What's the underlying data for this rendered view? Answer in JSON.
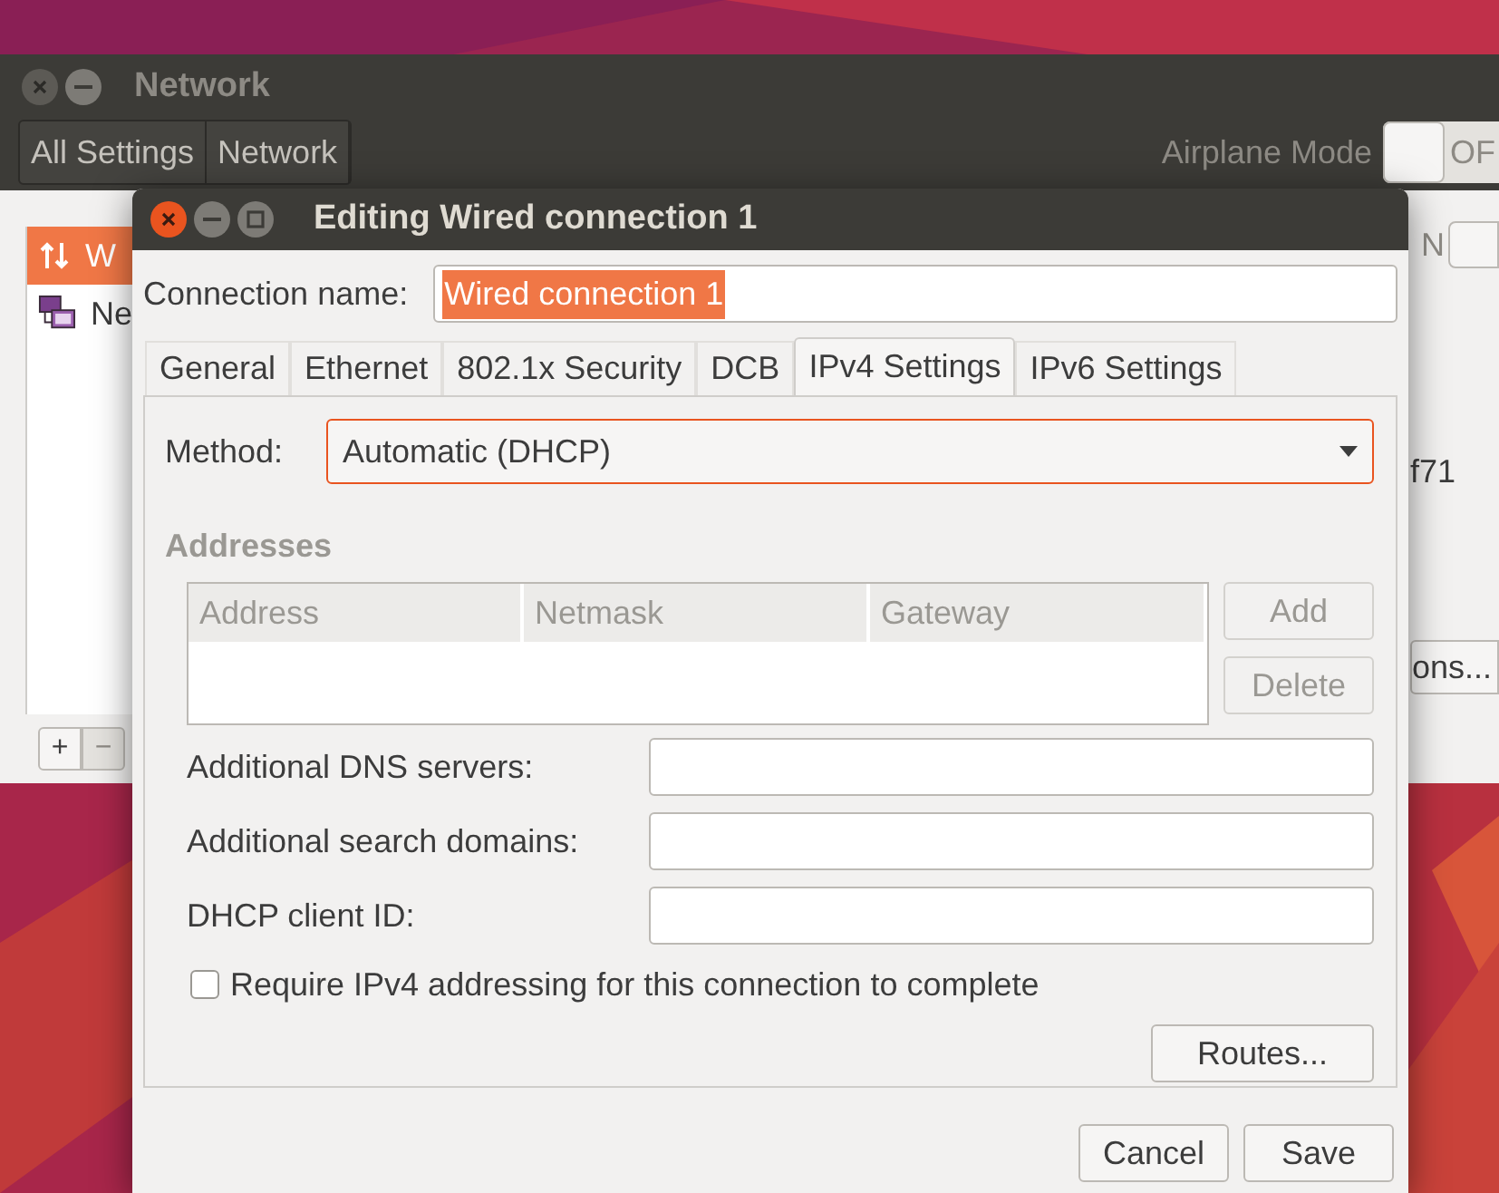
{
  "background_window": {
    "title": "Network",
    "toolbar": [
      "All Settings",
      "Network"
    ],
    "airplane_mode": {
      "label": "Airplane Mode",
      "switch_text": "OF",
      "on": false
    },
    "sidebar": {
      "items": [
        {
          "label": "W",
          "kind": "wired",
          "selected": true
        },
        {
          "label": "Ne",
          "kind": "network",
          "selected": false
        }
      ],
      "buttons": [
        "+",
        "−"
      ]
    },
    "detail": {
      "switch_text": "N",
      "switch_on": true,
      "text": "f71",
      "button": "ons..."
    }
  },
  "dialog": {
    "title": "Editing Wired connection 1",
    "connection_name": {
      "label": "Connection name:",
      "value": "Wired connection 1",
      "text_selected": true
    },
    "tabs": [
      {
        "label": "General",
        "selected": false
      },
      {
        "label": "Ethernet",
        "selected": false
      },
      {
        "label": "802.1x Security",
        "selected": false
      },
      {
        "label": "DCB",
        "selected": false
      },
      {
        "label": "IPv4 Settings",
        "selected": true
      },
      {
        "label": "IPv6 Settings",
        "selected": false
      }
    ],
    "method": {
      "label": "Method:",
      "value": "Automatic (DHCP)",
      "focused": true
    },
    "addresses": {
      "heading": "Addresses",
      "columns": [
        "Address",
        "Netmask",
        "Gateway"
      ],
      "buttons": [
        {
          "label": "Add",
          "disabled": true
        },
        {
          "label": "Delete",
          "disabled": true
        }
      ]
    },
    "fields": [
      {
        "label": "Additional DNS servers:"
      },
      {
        "label": "Additional search domains:"
      },
      {
        "label": "DHCP client ID:"
      }
    ],
    "checkbox": {
      "label": "Require IPv4 addressing for this connection to complete",
      "checked": false
    },
    "routes_button": "Routes...",
    "buttons": [
      "Cancel",
      "Save"
    ]
  }
}
